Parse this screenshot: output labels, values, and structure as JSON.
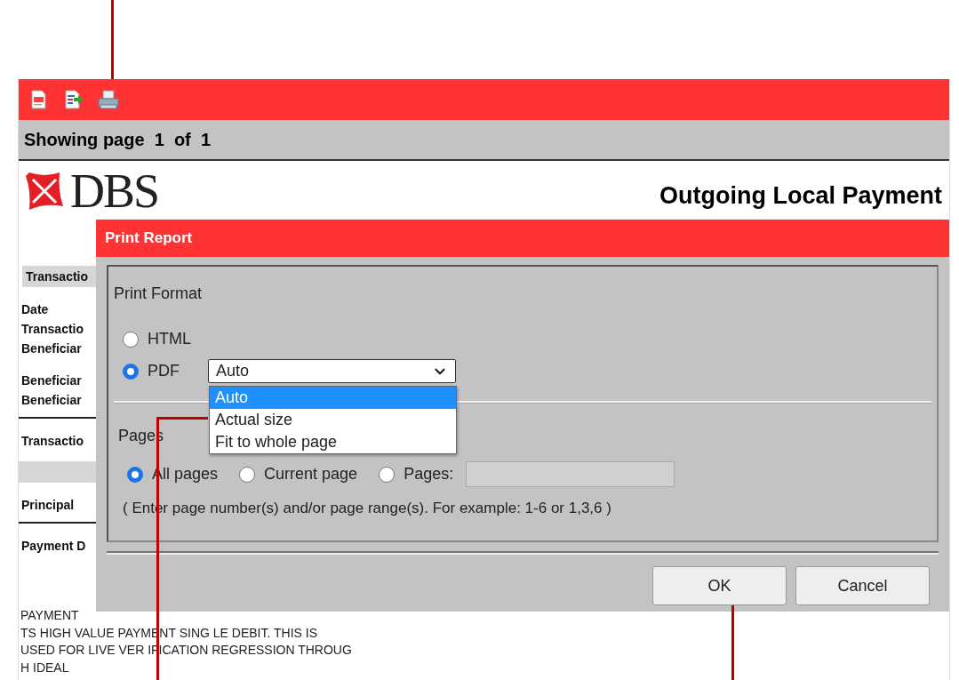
{
  "page_bar": {
    "text": "Showing page  1  of  1"
  },
  "report": {
    "logo": "DBS",
    "title": "Outgoing Local Payment",
    "sections": [
      {
        "kind": "band",
        "label": "Transactio"
      },
      {
        "kind": "fields",
        "labels": [
          "Date",
          "Transactio",
          "Beneficiar"
        ]
      },
      {
        "kind": "fields",
        "labels": [
          "Beneficiar",
          "Beneficiar"
        ]
      },
      {
        "kind": "rule"
      },
      {
        "kind": "fields",
        "labels": [
          "Transactio"
        ]
      },
      {
        "kind": "band"
      },
      {
        "kind": "fields",
        "labels": [
          "Principal"
        ]
      },
      {
        "kind": "rule"
      },
      {
        "kind": "fields",
        "labels": [
          "Payment D"
        ]
      },
      {
        "kind": "text",
        "lines": [
          "PAYMENT",
          "TS HIGH VALUE PAYMENT SING LE DEBIT. THIS IS",
          "USED FOR LIVE VER IFICATION REGRESSION THROUG",
          "H IDEAL"
        ]
      }
    ]
  },
  "dialog": {
    "title": "Print Report",
    "format": {
      "legend": "Print Format",
      "options": [
        {
          "label": "HTML",
          "selected": false
        },
        {
          "label": "PDF",
          "selected": true
        }
      ],
      "select": {
        "value": "Auto",
        "expanded": true,
        "options": [
          {
            "label": "Auto",
            "selected": true
          },
          {
            "label": "Actual size",
            "selected": false
          },
          {
            "label": "Fit to whole page",
            "selected": false
          }
        ]
      }
    },
    "pages": {
      "legend": "Pages",
      "options": [
        {
          "label": "All pages",
          "selected": true
        },
        {
          "label": "Current page",
          "selected": false
        },
        {
          "label": "Pages:",
          "selected": false
        }
      ],
      "range_field": {
        "disabled": true
      },
      "hint": "( Enter page number(s) and/or page range(s). For example: 1-6 or 1,3,6 )"
    },
    "buttons": [
      "OK",
      "Cancel"
    ]
  }
}
